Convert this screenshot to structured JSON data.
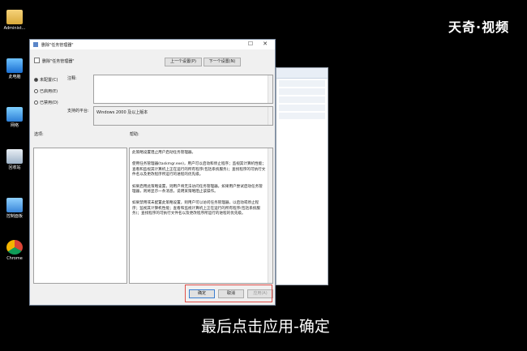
{
  "desktop": {
    "icons": [
      {
        "label": "Administ...",
        "icon": "user-folder-icon"
      },
      {
        "label": "此电脑",
        "icon": "computer-icon"
      },
      {
        "label": "网络",
        "icon": "network-icon"
      },
      {
        "label": "回收站",
        "icon": "recycle-bin-icon"
      },
      {
        "label": "控制面板",
        "icon": "control-panel-icon"
      },
      {
        "label": "Chrome",
        "icon": "chrome-icon"
      }
    ]
  },
  "watermark": "天奇·视频",
  "caption": "最后点击应用-确定",
  "dialog": {
    "title": "删除\"任务管理器\"",
    "header_title": "删除\"任务管理器\"",
    "prev_button": "上一个设置(P)",
    "next_button": "下一个设置(N)",
    "radio_not_configured": "未配置(C)",
    "radio_enabled": "已启用(E)",
    "radio_disabled": "已禁用(D)",
    "comment_label": "注释:",
    "supported_label": "支持的平台:",
    "supported_value": "Windows 2000 及以上版本",
    "options_label": "选项:",
    "help_label": "帮助:",
    "help_paragraphs": [
      "此策略设置阻止用户启动任务管理器。",
      "使用任务管理器(taskmgr.exe)，用户可以启动和停止程序；监视其计算机性能；查看和监视其计算机上正在运行的所有程序(包括系统服务)；查找程序的可执行文件名以及更改程序所运行的进程的优先级。",
      "如果启用此策略设置，则用户将无法访问任务管理器。如果用户尝试启动任务管理器，则将显示一条消息，说明某策略阻止该操作。",
      "如果禁用或未配置此策略设置，则用户可以访问任务管理器，以启动或停止程序；监视其计算机性能；查看和监视计算机上正在运行的所有程序(包括系统服务)；查找程序的可执行文件名以及更改程序所运行的进程的优先级。"
    ],
    "ok_button": "确定",
    "cancel_button": "取消",
    "apply_button": "应用(A)",
    "colors": {
      "highlight": "#e0504a"
    }
  }
}
